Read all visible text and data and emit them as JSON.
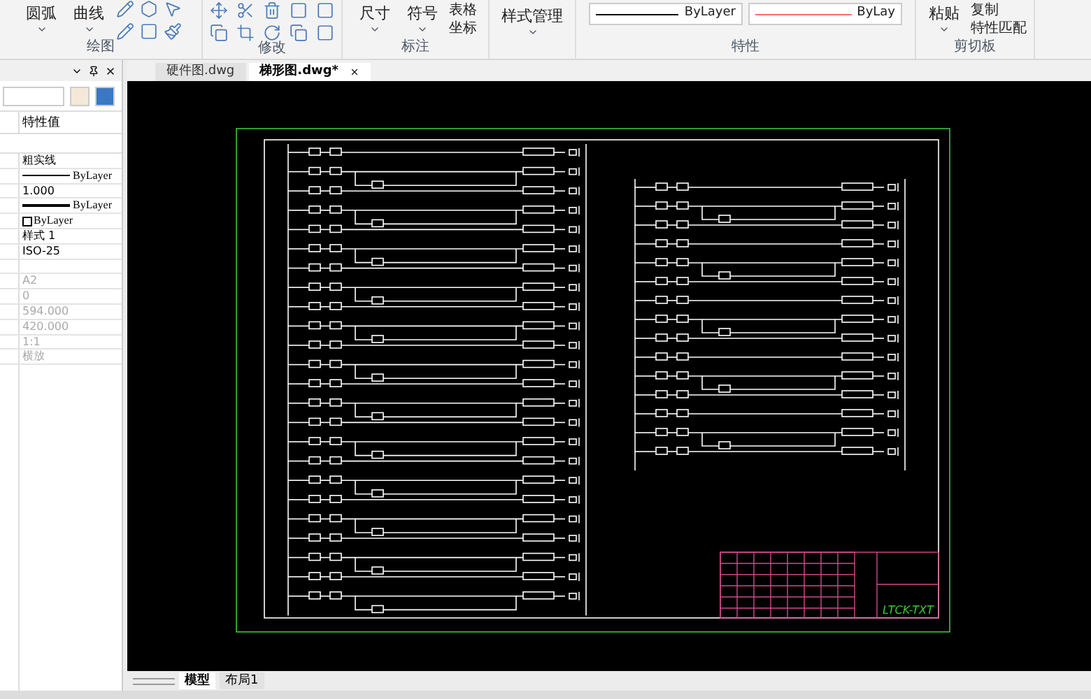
{
  "ribbon": {
    "draw": {
      "label": "绘图",
      "buttons": [
        "圆弧",
        "曲线"
      ]
    },
    "modify": {
      "label": "修改"
    },
    "annotate": {
      "label": "标注",
      "buttons": [
        "尺寸",
        "符号"
      ],
      "small_buttons": [
        "表格",
        "坐标"
      ]
    },
    "style": {
      "button": "样式管理"
    },
    "properties": {
      "label": "特性",
      "linetypes": [
        {
          "text": "ByLayer",
          "color": "#000000"
        },
        {
          "text": "ByLay",
          "color": "#f07070"
        }
      ]
    },
    "clipboard": {
      "label": "剪切板",
      "paste": "粘贴",
      "small_buttons": [
        "复制",
        "特性匹配"
      ]
    }
  },
  "panel": {
    "header": "特性值",
    "rows": [
      {
        "kind": "text",
        "value": "粗实线",
        "disabled": false
      },
      {
        "kind": "thin-line",
        "value": "ByLayer",
        "disabled": false
      },
      {
        "kind": "text",
        "value": "1.000",
        "disabled": false
      },
      {
        "kind": "thick-line",
        "value": "ByLayer",
        "disabled": false
      },
      {
        "kind": "swatch",
        "value": "ByLayer",
        "disabled": false
      },
      {
        "kind": "text",
        "value": "样式 1",
        "disabled": false
      },
      {
        "kind": "text",
        "value": "ISO-25",
        "disabled": false
      },
      {
        "kind": "blank"
      },
      {
        "kind": "text",
        "value": "A2",
        "disabled": true
      },
      {
        "kind": "text",
        "value": "0",
        "disabled": true
      },
      {
        "kind": "text",
        "value": "594.000",
        "disabled": true
      },
      {
        "kind": "text",
        "value": "420.000",
        "disabled": true
      },
      {
        "kind": "text",
        "value": "1:1",
        "disabled": true
      },
      {
        "kind": "text",
        "value": "横放",
        "disabled": true
      }
    ]
  },
  "doc_tabs": [
    {
      "label": "硬件图.dwg",
      "selected": false
    },
    {
      "label": "梯形图.dwg*",
      "selected": true
    }
  ],
  "drawing": {
    "title_block_code": "LTCK-TXT"
  },
  "layout_tabs": [
    {
      "label": "模型",
      "selected": true
    },
    {
      "label": "布局1",
      "selected": false
    }
  ]
}
